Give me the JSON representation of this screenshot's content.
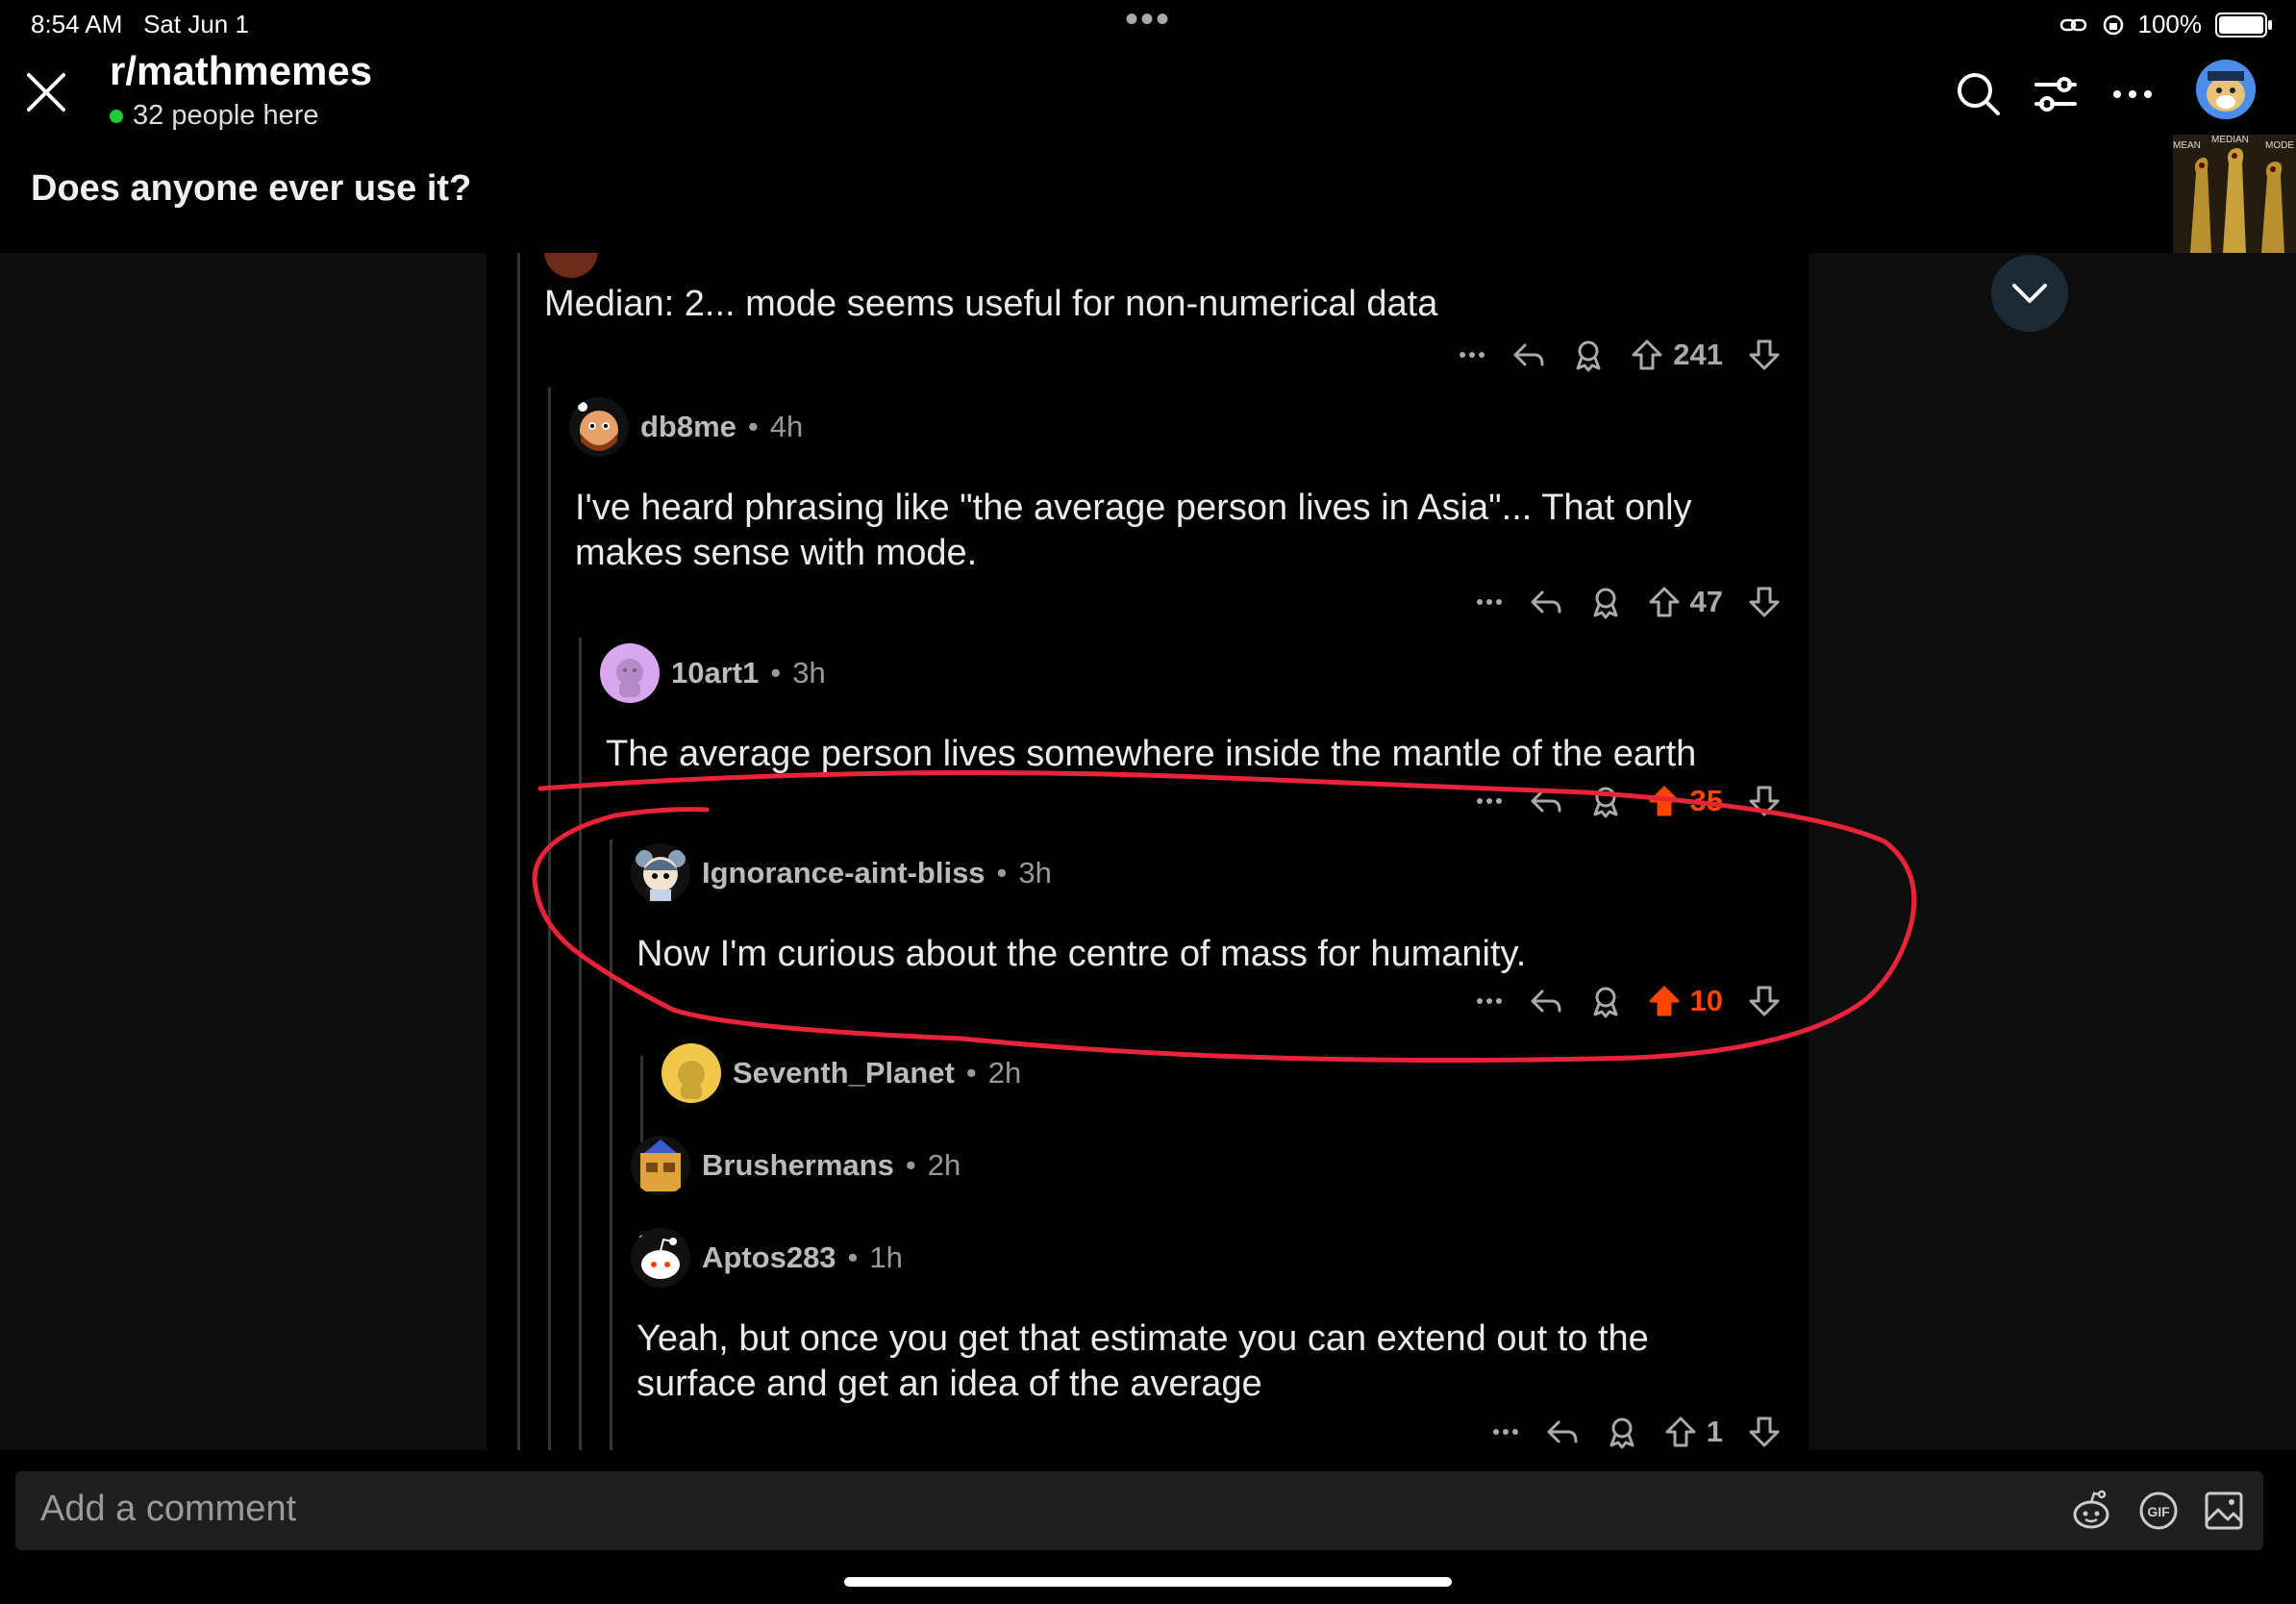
{
  "status_bar": {
    "time": "8:54 AM",
    "date": "Sat Jun 1",
    "battery": "100%",
    "battery_level": 1.0
  },
  "header": {
    "subreddit": "r/mathmemes",
    "online": "32 people here",
    "post_title": "Does anyone ever use it?",
    "thumbnail_labels": [
      "MEAN",
      "MEDIAN",
      "MODE"
    ]
  },
  "comments": [
    {
      "text": "Median: 2... mode seems useful for non-numerical data",
      "score": "241",
      "upvoted": false
    },
    {
      "user": "db8me",
      "time": "4h",
      "text": "I've heard phrasing like \"the average person lives in Asia\"... That only makes sense with mode.",
      "score": "47",
      "upvoted": false
    },
    {
      "user": "10art1",
      "time": "3h",
      "text": "The average person lives somewhere inside the mantle of the earth",
      "score": "35",
      "upvoted": true
    },
    {
      "user": "Ignorance-aint-bliss",
      "time": "3h",
      "text": "Now I'm curious about the centre of mass for humanity.",
      "score": "10",
      "upvoted": true
    },
    {
      "user": "Seventh_Planet",
      "time": "2h"
    },
    {
      "user": "Brushermans",
      "time": "2h"
    },
    {
      "user": "Aptos283",
      "time": "1h",
      "text": "Yeah, but once you get that estimate you can extend out to the surface and get an idea of the average",
      "score": "1",
      "upvoted": false
    }
  ],
  "separator": "•",
  "composer": {
    "placeholder": "Add a comment"
  },
  "colors": {
    "upvote": "#ff4500",
    "annotation": "#e8233a",
    "online": "#1fcb3a"
  }
}
